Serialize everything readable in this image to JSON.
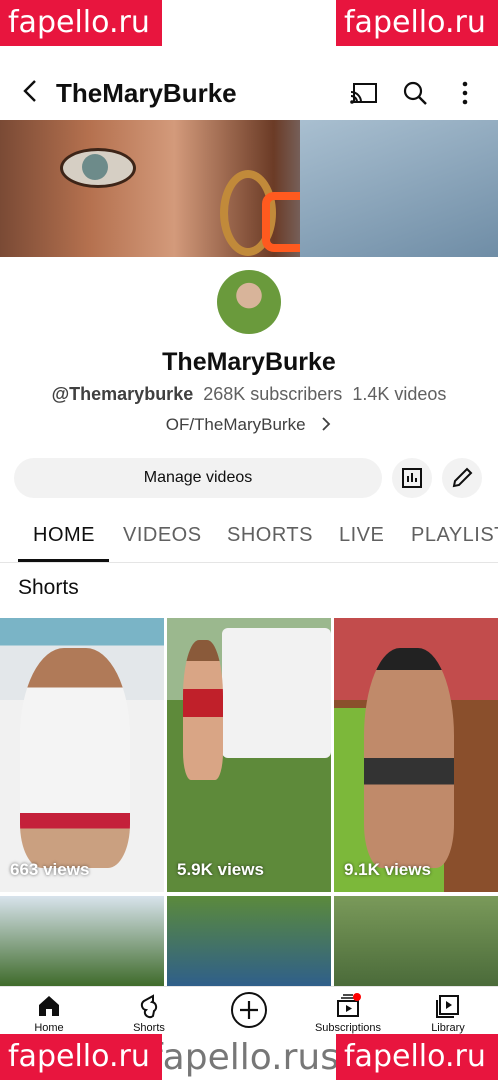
{
  "watermark": {
    "text": "fapello.ru",
    "bottom_url": "fapello.russ.com/ma"
  },
  "appbar": {
    "title": "TheMaryBurke"
  },
  "channel": {
    "name": "TheMaryBurke",
    "handle": "@Themaryburke",
    "subscribers": "268K subscribers",
    "videos": "1.4K videos",
    "link": "OF/TheMaryBurke"
  },
  "actions": {
    "manage_label": "Manage videos"
  },
  "tabs": [
    "HOME",
    "VIDEOS",
    "SHORTS",
    "LIVE",
    "PLAYLISTS"
  ],
  "section": {
    "title": "Shorts"
  },
  "shorts": [
    {
      "views": "663 views"
    },
    {
      "views": "5.9K views"
    },
    {
      "views": "9.1K views"
    }
  ],
  "nav": {
    "home": "Home",
    "shorts": "Shorts",
    "subscriptions": "Subscriptions",
    "library": "Library"
  },
  "colors": {
    "watermark_bg": "#e8153e",
    "tab_active": "#0f0f0f",
    "notification_dot": "#ff0000"
  }
}
